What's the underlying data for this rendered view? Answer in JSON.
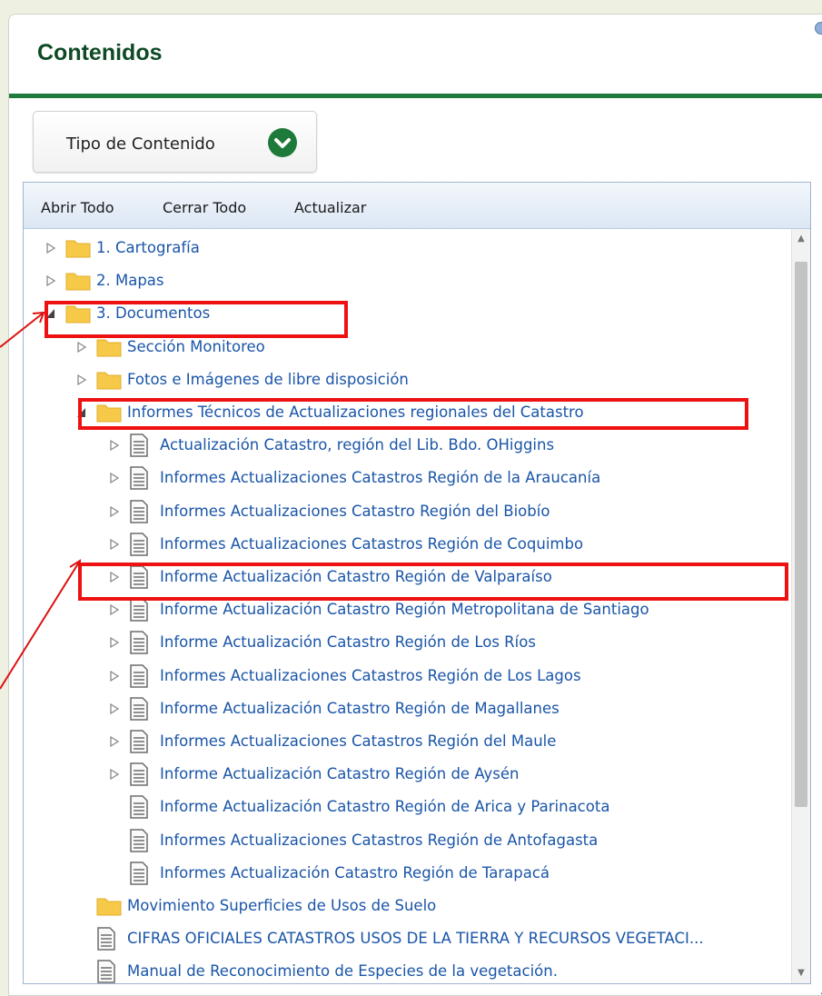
{
  "panel": {
    "title": "Contenidos",
    "type_button": {
      "label": "Tipo de Contenido",
      "icon": "chevron-down-circle-icon"
    }
  },
  "toolbar": {
    "open_all": "Abrir Todo",
    "close_all": "Cerrar Todo",
    "refresh": "Actualizar"
  },
  "tree": {
    "items": [
      {
        "label": "1. Cartografía",
        "type": "folder",
        "expander": "collapsed",
        "level": 0
      },
      {
        "label": "2. Mapas",
        "type": "folder",
        "expander": "collapsed",
        "level": 0
      },
      {
        "label": "3. Documentos",
        "type": "folder",
        "expander": "expanded",
        "level": 0,
        "highlighted": true
      },
      {
        "label": "Sección Monitoreo",
        "type": "folder",
        "expander": "collapsed",
        "level": 1
      },
      {
        "label": "Fotos e Imágenes de libre disposición",
        "type": "folder",
        "expander": "collapsed",
        "level": 1
      },
      {
        "label": "Informes Técnicos de Actualizaciones regionales del Catastro",
        "type": "folder",
        "expander": "expanded",
        "level": 1,
        "highlighted": true
      },
      {
        "label": "Actualización Catastro, región del Lib. Bdo. OHiggins",
        "type": "doc",
        "expander": "collapsed",
        "level": 2
      },
      {
        "label": "Informes Actualizaciones Catastros Región de la Araucanía",
        "type": "doc",
        "expander": "collapsed",
        "level": 2
      },
      {
        "label": "Informes Actualizaciones Catastro Región del Biobío",
        "type": "doc",
        "expander": "collapsed",
        "level": 2
      },
      {
        "label": "Informes Actualizaciones Catastros Región de Coquimbo",
        "type": "doc",
        "expander": "collapsed",
        "level": 2
      },
      {
        "label": "Informe Actualización Catastro Región de Valparaíso",
        "type": "doc",
        "expander": "collapsed",
        "level": 2,
        "highlighted": true
      },
      {
        "label": "Informe Actualización Catastro Región Metropolitana de Santiago",
        "type": "doc",
        "expander": "collapsed",
        "level": 2
      },
      {
        "label": "Informe Actualización Catastro Región de Los Ríos",
        "type": "doc",
        "expander": "collapsed",
        "level": 2
      },
      {
        "label": "Informes Actualizaciones Catastros Región de Los Lagos",
        "type": "doc",
        "expander": "collapsed",
        "level": 2
      },
      {
        "label": "Informe Actualización Catastro Región de Magallanes",
        "type": "doc",
        "expander": "collapsed",
        "level": 2
      },
      {
        "label": "Informes Actualizaciones Catastros Región del Maule",
        "type": "doc",
        "expander": "collapsed",
        "level": 2
      },
      {
        "label": "Informe Actualización Catastro Región de Aysén",
        "type": "doc",
        "expander": "collapsed",
        "level": 2
      },
      {
        "label": "Informe Actualización Catastro Región de Arica y Parinacota",
        "type": "doc",
        "expander": "none",
        "level": 2
      },
      {
        "label": "Informes Actualizaciones Catastros Región de Antofagasta",
        "type": "doc",
        "expander": "none",
        "level": 2
      },
      {
        "label": "Informes Actualización Catastro Región de Tarapacá",
        "type": "doc",
        "expander": "none",
        "level": 2
      },
      {
        "label": "Movimiento Superficies de Usos de Suelo",
        "type": "folder",
        "expander": "none",
        "level": 1
      },
      {
        "label": "CIFRAS OFICIALES CATASTROS USOS DE LA TIERRA Y RECURSOS VEGETACI...",
        "type": "doc",
        "expander": "none",
        "level": 1
      },
      {
        "label": "Manual de Reconocimiento de Especies de la vegetación.",
        "type": "doc",
        "expander": "none",
        "level": 1
      }
    ]
  },
  "colors": {
    "accent_green": "#1f7a3c",
    "link_blue": "#1a55a8",
    "highlight_red": "#ee1111",
    "folder_yellow": "#f7c948"
  }
}
